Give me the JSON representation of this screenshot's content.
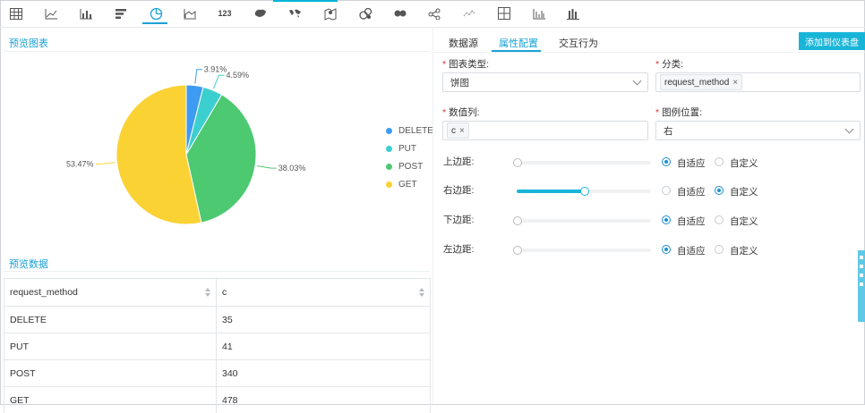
{
  "toolbar": {
    "icons": [
      "table-icon",
      "line-chart-icon",
      "column-chart-icon",
      "bar-chart-icon",
      "pie-chart-icon",
      "area-chart-icon",
      "number-icon",
      "map-china-icon",
      "world-map-icon",
      "pin-map-icon",
      "bubble-icon",
      "cluster-icon",
      "network-icon",
      "scatter-icon",
      "layout-icon",
      "funnel-icon",
      "histogram-icon"
    ],
    "number_label": "123",
    "active_index": 4
  },
  "preview_chart": {
    "title": "预览图表",
    "legend": [
      {
        "label": "DELETE",
        "color": "#3e9bf2"
      },
      {
        "label": "PUT",
        "color": "#3ccfcf"
      },
      {
        "label": "POST",
        "color": "#4dc972"
      },
      {
        "label": "GET",
        "color": "#fad234"
      }
    ]
  },
  "chart_data": {
    "type": "pie",
    "categories": [
      "DELETE",
      "PUT",
      "POST",
      "GET"
    ],
    "values": [
      35,
      41,
      340,
      478
    ],
    "percent_labels": [
      "3.91%",
      "4.59%",
      "38.03%",
      "53.47%"
    ],
    "colors": [
      "#3e9bf2",
      "#3ccfcf",
      "#4dc972",
      "#fad234"
    ],
    "legend_position": "right"
  },
  "preview_data": {
    "title": "预览数据",
    "columns": [
      "request_method",
      "c"
    ],
    "rows": [
      [
        "DELETE",
        "35"
      ],
      [
        "PUT",
        "41"
      ],
      [
        "POST",
        "340"
      ],
      [
        "GET",
        "478"
      ]
    ]
  },
  "tabs": [
    "数据源",
    "属性配置",
    "交互行为"
  ],
  "active_tab": "属性配置",
  "add_button": "添加到仪表盘",
  "form": {
    "chart_type_label": "图表类型:",
    "chart_type_value": "饼图",
    "category_label": "分类:",
    "category_tag": "request_method",
    "value_col_label": "数值列:",
    "value_col_tag": "c",
    "legend_pos_label": "图例位置:",
    "legend_pos_value": "右",
    "required_mark": "*",
    "tag_close": "×"
  },
  "margins": [
    {
      "label": "上边距:",
      "mode": "auto"
    },
    {
      "label": "右边距:",
      "mode": "custom",
      "value_pct": 50
    },
    {
      "label": "下边距:",
      "mode": "auto"
    },
    {
      "label": "左边距:",
      "mode": "auto"
    }
  ],
  "radio_labels": {
    "auto": "自适应",
    "custom": "自定义"
  }
}
